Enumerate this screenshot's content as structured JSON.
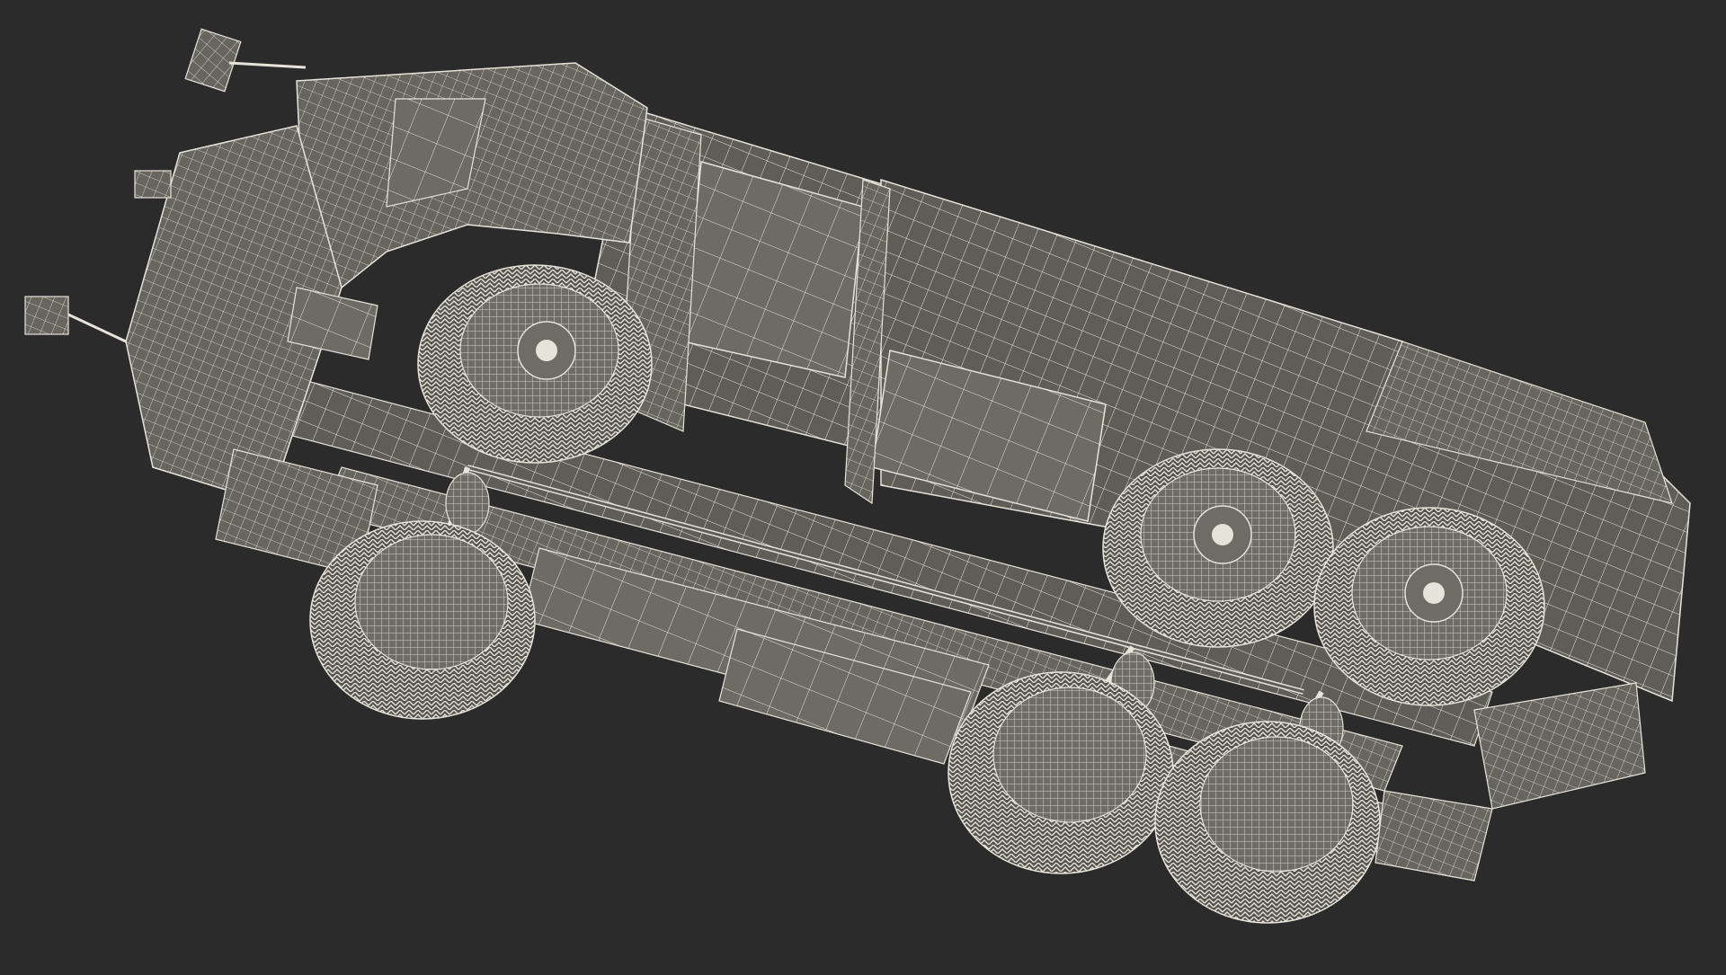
{
  "scene": {
    "subject": "wireframe-truck",
    "background_color": "#2b2b2b",
    "mesh_color": "#e6e3da",
    "surface_color": "#5e5d57",
    "wheel_count": 6
  }
}
